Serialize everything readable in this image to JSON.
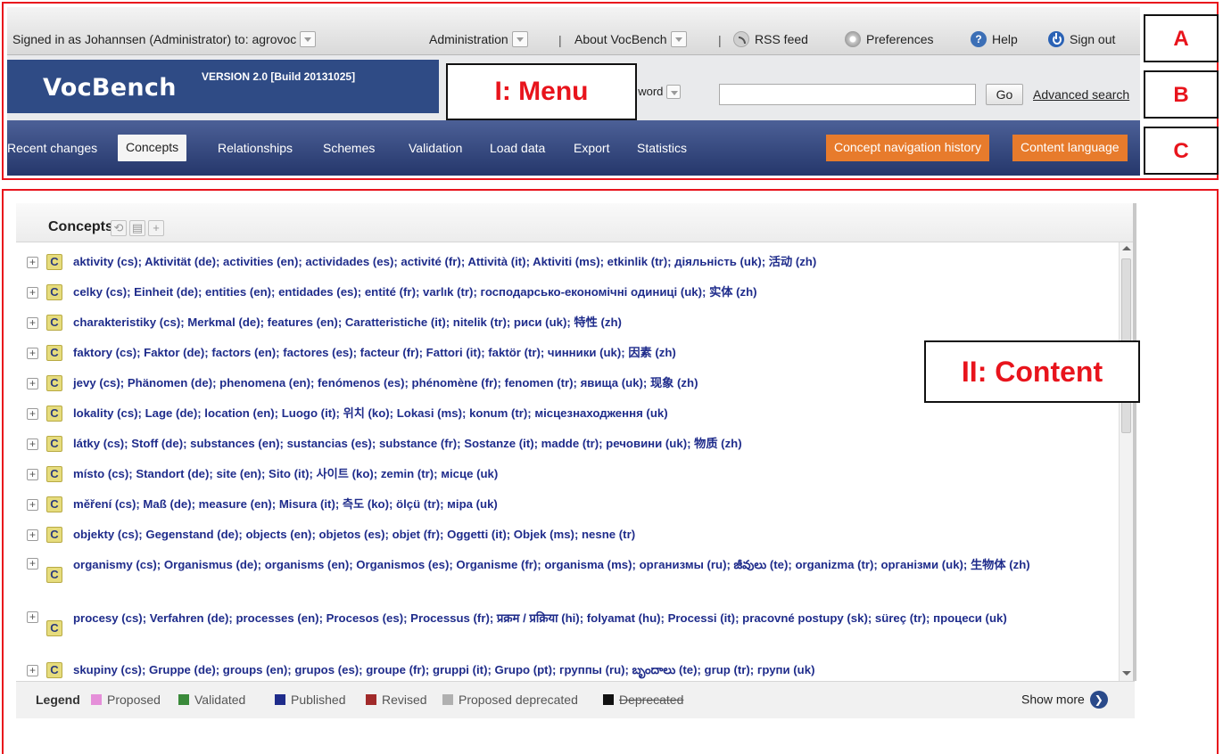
{
  "topbar": {
    "signed_in_text": "Signed in as Johannsen (Administrator) to:",
    "project": "agrovoc",
    "administration": "Administration",
    "separator": "|",
    "about": "About VocBench",
    "rss": "RSS feed",
    "preferences": "Preferences",
    "help": "Help",
    "signout": "Sign out",
    "icons": {
      "rss": "rss-icon",
      "preferences": "gear-icon",
      "help": "help-icon",
      "signout": "power-icon"
    }
  },
  "header": {
    "app_name": "VocBench",
    "version": "VERSION 2.0 [Build 20131025]",
    "search_type": "t word",
    "search_value": "",
    "go": "Go",
    "advanced_search": "Advanced search"
  },
  "nav": {
    "tabs": [
      "Recent changes",
      "Concepts",
      "Relationships",
      "Schemes",
      "Validation",
      "Load data",
      "Export",
      "Statistics"
    ],
    "active_tab": "Concepts",
    "nav_history": "Concept navigation history",
    "content_language": "Content language"
  },
  "annotations": {
    "a": "A",
    "b": "B",
    "c": "C",
    "menu": "I: Menu",
    "content": "II: Content"
  },
  "panel": {
    "title": "Concepts",
    "toolbar_icons": [
      "refresh-icon",
      "tree-icon",
      "add-icon"
    ],
    "concepts": [
      "aktivity (cs); Aktivität (de); activities (en); actividades (es); activité (fr); Attività (it); Aktiviti (ms); etkinlik (tr); діяльність (uk); 活动 (zh)",
      "celky (cs); Einheit (de); entities (en); entidades (es); entité (fr); varlık (tr); господарсько-економічні одиниці (uk); 实体 (zh)",
      "charakteristiky (cs); Merkmal (de); features (en); Caratteristiche (it); nitelik (tr); риси (uk); 特性 (zh)",
      "faktory (cs); Faktor (de); factors (en); factores (es); facteur (fr); Fattori (it); faktör (tr); чинники (uk); 因素 (zh)",
      "jevy (cs); Phänomen (de); phenomena (en); fenómenos (es); phénomène (fr); fenomen (tr); явища (uk); 现象 (zh)",
      "lokality (cs); Lage (de); location (en); Luogo (it); 위치 (ko); Lokasi (ms); konum (tr); місцезнаходження (uk)",
      "látky (cs); Stoff (de); substances (en); sustancias (es); substance (fr); Sostanze (it); madde (tr); речовини (uk); 物质 (zh)",
      "místo (cs); Standort (de); site (en); Sito (it); 사이트 (ko); zemin (tr); місце (uk)",
      "měření (cs); Maß (de); measure (en); Misura (it); 측도 (ko); ölçü (tr); міра (uk)",
      "objekty (cs); Gegenstand (de); objects (en); objetos (es); objet (fr); Oggetti (it); Objek (ms); nesne (tr)",
      "organismy (cs); Organismus (de); organisms (en); Organismos (es); Organisme (fr); organisma (ms); организмы (ru); జీవులు (te); organizma (tr); організми (uk); 生物体 (zh)",
      "procesy (cs); Verfahren (de); processes (en); Procesos (es); Processus (fr); प्रक्रम / प्रक्रिया (hi); folyamat (hu); Processi (it); pracovné postupy (sk); süreç (tr); процеси (uk)",
      "skupiny (cs); Gruppe (de); groups (en); grupos (es); groupe (fr); gruppi (it); Grupo (pt); группы (ru); బృందాలు (te); grup (tr); групи (uk)"
    ],
    "concept_badge": "C",
    "expand_icon": "+"
  },
  "legend": {
    "title": "Legend",
    "items": [
      {
        "label": "Proposed",
        "color": "#e58fd9"
      },
      {
        "label": "Validated",
        "color": "#3a8a3a"
      },
      {
        "label": "Published",
        "color": "#1f2c8b"
      },
      {
        "label": "Revised",
        "color": "#a12a2a"
      },
      {
        "label": "Proposed deprecated",
        "color": "#b0b0b0"
      },
      {
        "label": "Deprecated",
        "color": "#111111"
      }
    ],
    "show_more": "Show more"
  }
}
